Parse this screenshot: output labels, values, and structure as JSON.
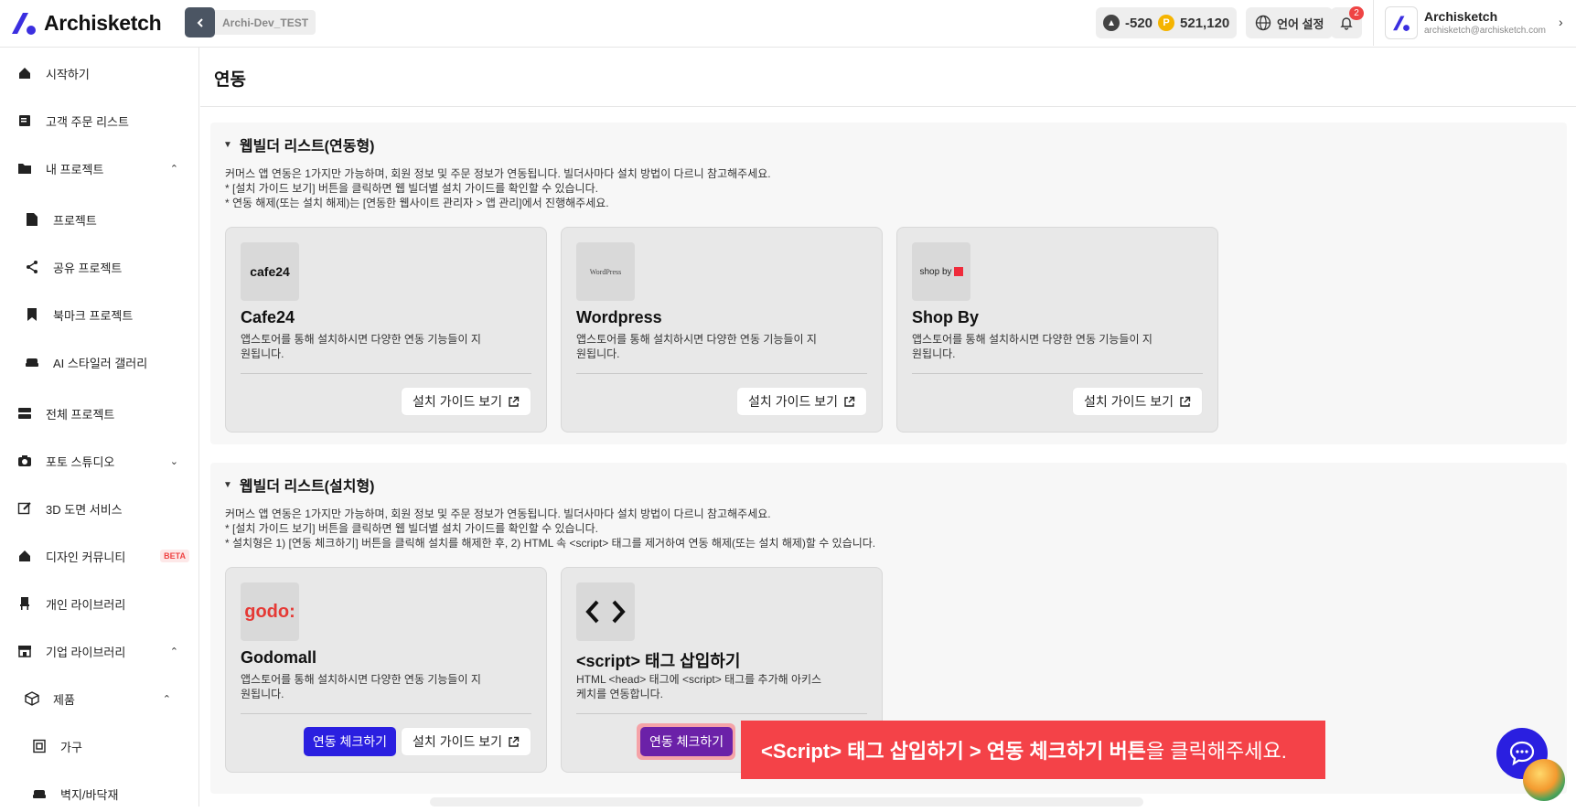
{
  "app": {
    "name": "Archisketch"
  },
  "header": {
    "project_name": "Archi-Dev_TEST",
    "credit_value": "-520",
    "point_symbol": "P",
    "point_value": "521,120",
    "language_label": "언어 설정",
    "notification_count": "2",
    "user_name": "Archisketch",
    "user_email": "archisketch@archisketch.com"
  },
  "sidebar": {
    "items": [
      {
        "label": "시작하기",
        "icon": "home-icon"
      },
      {
        "label": "고객 주문 리스트",
        "icon": "order-list-icon"
      },
      {
        "label": "내 프로젝트",
        "icon": "folder-icon",
        "expanded": true
      },
      {
        "label": "프로젝트",
        "icon": "file-icon"
      },
      {
        "label": "공유 프로젝트",
        "icon": "share-icon"
      },
      {
        "label": "북마크 프로젝트",
        "icon": "bookmark-icon"
      },
      {
        "label": "AI 스타일러 갤러리",
        "icon": "sofa-icon"
      },
      {
        "label": "전체 프로젝트",
        "icon": "server-icon"
      },
      {
        "label": "포토 스튜디오",
        "icon": "camera-icon",
        "expanded": false
      },
      {
        "label": "3D 도면 서비스",
        "icon": "edit-icon"
      },
      {
        "label": "디자인 커뮤니티",
        "icon": "home-icon",
        "badge": "BETA"
      },
      {
        "label": "개인 라이브러리",
        "icon": "chair-icon"
      },
      {
        "label": "기업 라이브러리",
        "icon": "store-icon",
        "expanded": true
      },
      {
        "label": "제품",
        "icon": "cube-icon",
        "expanded": true
      },
      {
        "label": "가구",
        "icon": "cabinet-icon"
      },
      {
        "label": "벽지/바닥재",
        "icon": "sofa-icon"
      }
    ]
  },
  "page": {
    "title": "연동"
  },
  "sections": [
    {
      "title": "웹빌더 리스트(연동형)",
      "desc": [
        "커머스 앱 연동은 1가지만 가능하며, 회원 정보 및 주문 정보가 연동됩니다. 빌더사마다 설치 방법이 다르니 참고해주세요.",
        "* [설치 가이드 보기] 버튼을 클릭하면 웹 빌더별 설치 가이드를 확인할 수 있습니다.",
        "* 연동 해제(또는 설치 해제)는 [연동한 웹사이트 관리자 > 앱 관리]에서 진행해주세요."
      ],
      "cards": [
        {
          "name": "Cafe24",
          "logo_text": "cafe24",
          "desc": "앱스토어를 통해 설치하시면 다양한 연동 기능들이 지원됩니다.",
          "guide_label": "설치 가이드 보기"
        },
        {
          "name": "Wordpress",
          "logo_text": "WordPress",
          "desc": "앱스토어를 통해 설치하시면 다양한 연동 기능들이 지원됩니다.",
          "guide_label": "설치 가이드 보기"
        },
        {
          "name": "Shop By",
          "logo_text": "shop by",
          "desc": "앱스토어를 통해 설치하시면 다양한 연동 기능들이 지원됩니다.",
          "guide_label": "설치 가이드 보기"
        }
      ]
    },
    {
      "title": "웹빌더 리스트(설치형)",
      "desc": [
        "커머스 앱 연동은 1가지만 가능하며, 회원 정보 및 주문 정보가 연동됩니다. 빌더사마다 설치 방법이 다르니 참고해주세요.",
        "* [설치 가이드 보기] 버튼을 클릭하면 웹 빌더별 설치 가이드를 확인할 수 있습니다.",
        "* 설치형은 1) [연동 체크하기] 버튼을 클릭해 설치를 해제한 후, 2) HTML 속 <script> 태그를 제거하여 연동 해제(또는 설치 해제)할 수 있습니다."
      ],
      "cards": [
        {
          "name": "Godomall",
          "logo_text": "godo:",
          "desc": "앱스토어를 통해 설치하시면 다양한 연동 기능들이 지원됩니다.",
          "check_label": "연동 체크하기",
          "guide_label": "설치 가이드 보기"
        },
        {
          "name": "<script> 태그 삽입하기",
          "logo_text": "<>",
          "desc": "HTML <head> 태그에 <script> 태그를 추가해 아키스케치를 연동합니다.",
          "check_label": "연동 체크하기"
        }
      ]
    }
  ],
  "tooltip": {
    "bold": "<Script> 태그 삽입하기 > 연동 체크하기 버튼",
    "rest": "을 클릭해주세요."
  },
  "colors": {
    "accent": "#2a1fe0",
    "highlight_button": "#6b21a8",
    "banner": "#f44248"
  }
}
